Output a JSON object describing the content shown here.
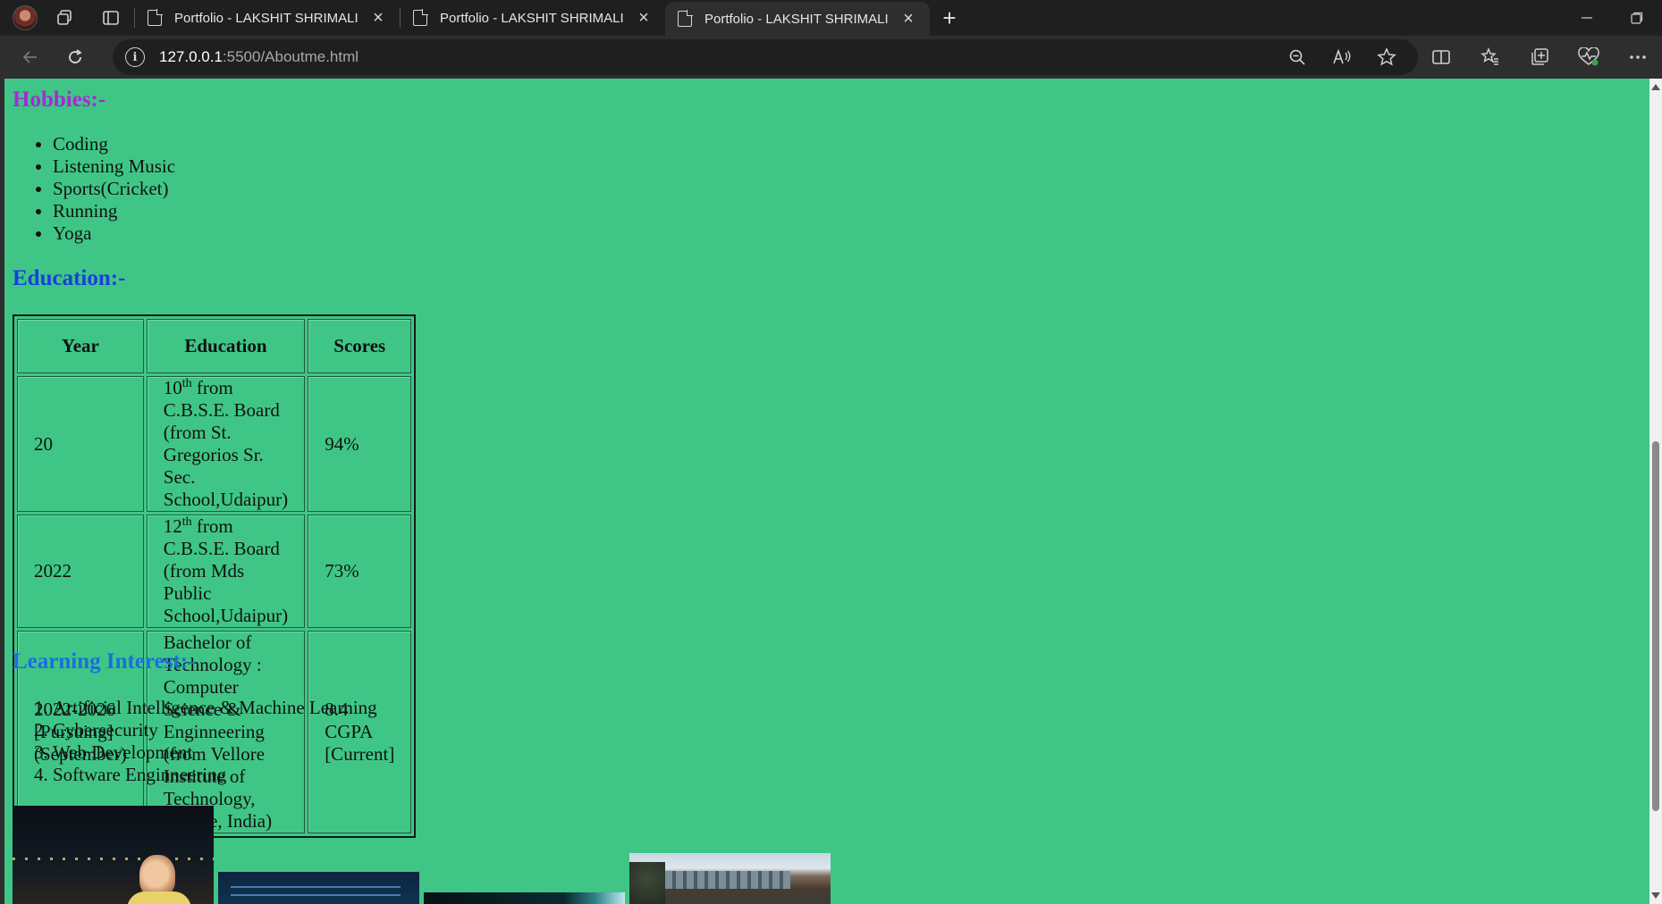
{
  "browser": {
    "tabs": [
      {
        "title": "Portfolio - LAKSHIT SHRIMALI",
        "active": false
      },
      {
        "title": "Portfolio - LAKSHIT SHRIMALI",
        "active": false
      },
      {
        "title": "Portfolio - LAKSHIT SHRIMALI",
        "active": true
      }
    ],
    "url_host": "127.0.0.1",
    "url_rest": ":5500/Aboutme.html",
    "icons": [
      "profile-avatar",
      "workspaces-icon",
      "tab-actions-icon",
      "new-tab-icon",
      "minimize-icon",
      "restore-icon",
      "back-icon",
      "refresh-icon",
      "site-info-icon",
      "zoom-out-icon",
      "read-aloud-icon",
      "favorite-star-icon",
      "split-screen-icon",
      "favorites-icon",
      "collections-icon",
      "browser-essentials-icon",
      "more-icon"
    ]
  },
  "page": {
    "background": "#3fc686",
    "hobbies": {
      "heading": "Hobbies:-",
      "color": "#a52ad6",
      "items": [
        "Coding",
        "Listening Music",
        "Sports(Cricket)",
        "Running",
        "Yoga"
      ]
    },
    "education": {
      "heading": "Education:-",
      "color": "#1a3ee0",
      "columns": [
        "Year",
        "Education",
        "Scores"
      ],
      "rows": [
        {
          "year": "20",
          "line1_pre": "10",
          "line1_sup": "th",
          "line1_post": " from C.B.S.E. Board",
          "line2": "(from St. Gregorios Sr. Sec. School,Udaipur)",
          "score": "94%"
        },
        {
          "year": "2022",
          "line1_pre": "12",
          "line1_sup": "th",
          "line1_post": " from C.B.S.E. Board",
          "line2": "(from Mds Public School,Udaipur)",
          "score": "73%"
        },
        {
          "year": "2022-2026 [Pursuing](September)",
          "line1_pre": "Bachelor of Technology : Computer Science & Enginneering",
          "line1_sup": "",
          "line1_post": "",
          "line2": "(from Vellore Institute of Technology, Vellore, India)",
          "score": "8.4 CGPA [Current]"
        }
      ]
    },
    "learning": {
      "heading": "Learning Interest:-",
      "color": "#1a6ee0",
      "items": [
        "Artificial Intelligence & Machine Learning",
        "Cybersecurity",
        "Web Development",
        "Software Enginneering"
      ]
    }
  }
}
